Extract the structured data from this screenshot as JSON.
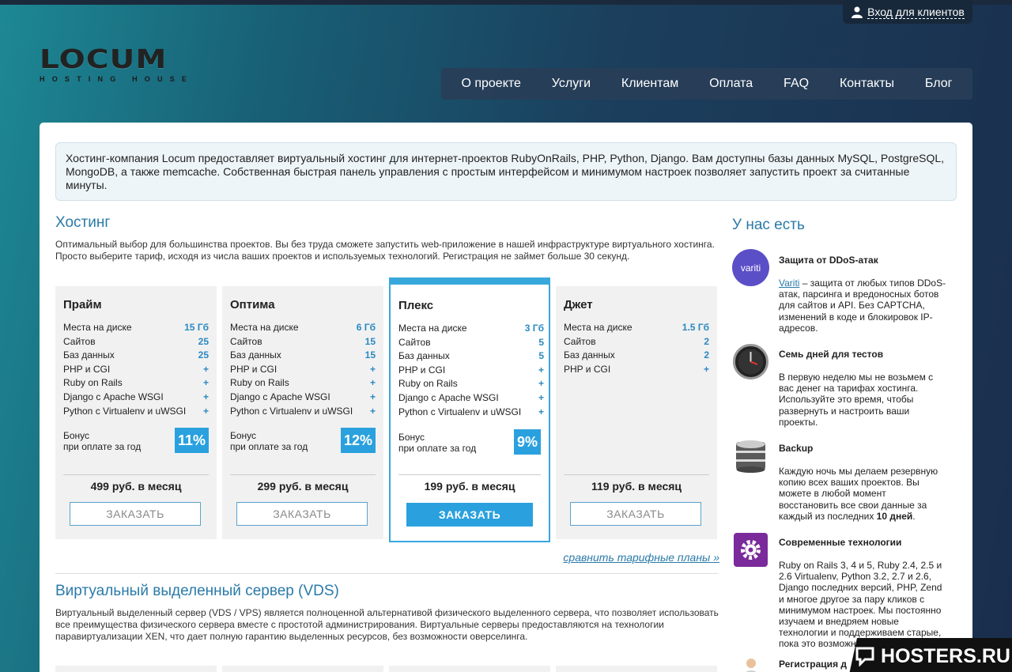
{
  "header": {
    "login_label": "Вход для клиентов",
    "logo_word": "LOCUM",
    "logo_tagline": "HOSTING HOUSE"
  },
  "nav": [
    "О проекте",
    "Услуги",
    "Клиентам",
    "Оплата",
    "FAQ",
    "Контакты",
    "Блог"
  ],
  "intro": "Хостинг-компания Locum предоставляет виртуальный хостинг для интернет-проектов RubyOnRails, PHP, Python, Django. Вам доступны базы данных MySQL, PostgreSQL, MongoDB, а также memcache. Собственная быстрая панель управления с простым интерфейсом и минимумом настроек позволяет запустить проект за считанные минуты.",
  "hosting": {
    "title": "Хостинг",
    "desc": "Оптимальный выбор для большинства проектов. Вы без труда сможете запустить web-приложение в нашей инфраструктуре виртуального хостинга. Просто выберите тариф, исходя из числа ваших проектов и используемых технологий. Регистрация не займет больше 30 секунд."
  },
  "plans": [
    {
      "name": "Прайм",
      "rows": [
        [
          "Места на диске",
          "15 Гб"
        ],
        [
          "Сайтов",
          "25"
        ],
        [
          "Баз данных",
          "25"
        ],
        [
          "PHP и CGI",
          "+"
        ],
        [
          "Ruby on Rails",
          "+"
        ],
        [
          "Django с Apache WSGI",
          "+"
        ],
        [
          "Python с Virtualenv и uWSGI",
          "+"
        ]
      ],
      "bonus1": "Бонус",
      "bonus2": "при оплате за год",
      "badge": "11%",
      "price": "499 руб. в месяц",
      "button": "ЗАКАЗАТЬ"
    },
    {
      "name": "Оптима",
      "rows": [
        [
          "Места на диске",
          "6 Гб"
        ],
        [
          "Сайтов",
          "15"
        ],
        [
          "Баз данных",
          "15"
        ],
        [
          "PHP и CGI",
          "+"
        ],
        [
          "Ruby on Rails",
          "+"
        ],
        [
          "Django с Apache WSGI",
          "+"
        ],
        [
          "Python с Virtualenv и uWSGI",
          "+"
        ]
      ],
      "bonus1": "Бонус",
      "bonus2": "при оплате за год",
      "badge": "12%",
      "price": "299 руб. в месяц",
      "button": "ЗАКАЗАТЬ"
    },
    {
      "name": "Плекс",
      "rows": [
        [
          "Места на диске",
          "3 Гб"
        ],
        [
          "Сайтов",
          "5"
        ],
        [
          "Баз данных",
          "5"
        ],
        [
          "PHP и CGI",
          "+"
        ],
        [
          "Ruby on Rails",
          "+"
        ],
        [
          "Django с Apache WSGI",
          "+"
        ],
        [
          "Python с Virtualenv и uWSGI",
          "+"
        ]
      ],
      "bonus1": "Бонус",
      "bonus2": "при оплате за год",
      "badge": "9%",
      "price": "199 руб. в месяц",
      "button": "ЗАКАЗАТЬ"
    },
    {
      "name": "Джет",
      "rows": [
        [
          "Места на диске",
          "1.5 Гб"
        ],
        [
          "Сайтов",
          "2"
        ],
        [
          "Баз данных",
          "2"
        ],
        [
          "PHP и CGI",
          "+"
        ]
      ],
      "price": "119 руб. в месяц",
      "button": "ЗАКАЗАТЬ"
    }
  ],
  "compare_link": "сравнить тарифные планы »",
  "vds": {
    "title": "Виртуальный выделенный сервер (VDS)",
    "desc": "Виртуальный выделенный сервер (VDS / VPS) является полноценной альтернативой физического выделенного сервера, что позволяет использовать все преимущества физического сервера вместе с простотой администрирования. Виртуальные серверы предоставляются на технологии паравиртуализации XEN, что дает полную гарантию выделенных ресурсов, без возможности оверселинга."
  },
  "sidebar": {
    "title": "У нас есть",
    "ddos": {
      "title": "Защита от DDoS-атак",
      "logo_text": "variti",
      "link": "Variti",
      "text": " – защита от любых типов DDoS-атак, парсинга и вредоносных ботов для сайтов и API. Без CAPTCHA, изменений в коде и блокировок IP-адресов."
    },
    "trial": {
      "title": "Семь дней для тестов",
      "text": "В первую неделю мы не возьмем с вас денег на тарифах хостинга. Используйте это время, чтобы развернуть и настроить ваши проекты."
    },
    "backup": {
      "title": "Backup",
      "text_a": "Каждую ночь мы делаем резервную копию всех ваших проектов. Вы можете в любой момент восстановить все свои данные за каждый из последних ",
      "text_bold": "10 дней",
      "text_b": "."
    },
    "tech": {
      "title": "Современные технологии",
      "text": "Ruby on Rails 3, 4 и 5, Ruby 2.4, 2.5 и 2.6 Virtualenv, Python 3.2, 2.7 и 2.6, Django последних версий, PHP, Zend и многое другое за пару кликов с минимумом настроек. Мы постоянно изучаем и внедряем новые технологии и поддерживаем старые, пока это возможно."
    },
    "reg": {
      "title": "Регистрация д"
    }
  },
  "watermark": "HOSTERS.RU",
  "colors": {
    "accent": "#2aa1de",
    "link": "#2a7aa8",
    "variti": "#5b4fc8",
    "tech": "#7a2a9a"
  }
}
